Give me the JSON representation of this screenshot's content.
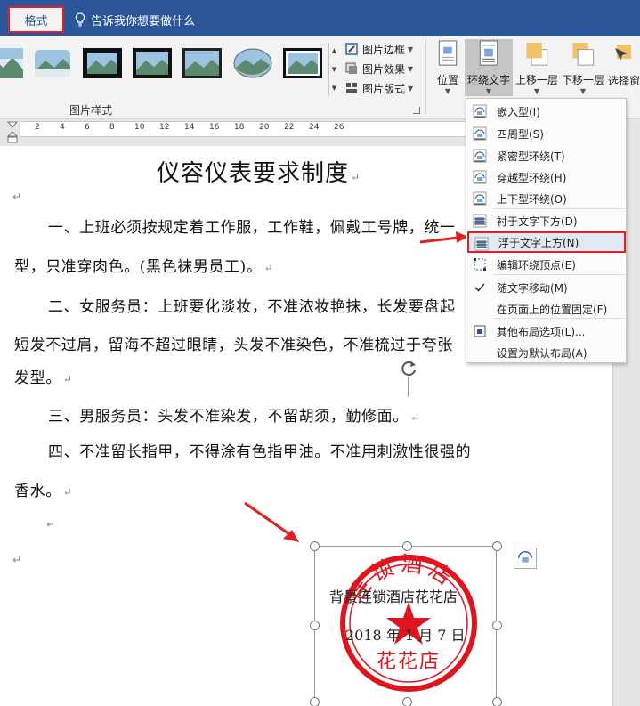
{
  "tabs": {
    "format_label": "格式",
    "tell_me_text": "告诉我你想要做什么"
  },
  "ribbon": {
    "picture_styles_label": "图片样式",
    "picture_border_label": "图片边框",
    "picture_effects_label": "图片效果",
    "picture_layout_label": "图片版式",
    "position_label": "位置",
    "wrap_text_label": "环绕文字",
    "bring_forward_label": "上移一层",
    "send_backward_label": "下移一层",
    "selection_pane_label": "选择窗"
  },
  "ruler": {
    "ticks": [
      "2",
      "4",
      "6",
      "8",
      "10",
      "12",
      "14",
      "16",
      "18",
      "20",
      "22",
      "24",
      "26"
    ]
  },
  "document": {
    "title": "仪容仪表要求制度",
    "lines": [
      "一、上班必须按规定着工作服，工作鞋，佩戴工号牌，统一",
      "型，只准穿肉色。(黑色袜男员工)。",
      "二、女服务员：上班要化淡妆，不准浓妆艳抹，长发要盘起",
      "短发不过肩，留海不超过眼睛，头发不准染色，不准梳过于夸张",
      "发型。",
      "三、男服务员：头发不准染发，不留胡须，勤修面。",
      "四、不准留长指甲，不得涂有色指甲油。不准用刺激性很强的",
      "香水。"
    ]
  },
  "image": {
    "caption_line1": "背景连锁酒店花花店",
    "caption_line2": "2018 年 1 月 7 日",
    "stamp_arc_text": "连锁酒店",
    "stamp_bottom_text": "花花店"
  },
  "wrap_menu": {
    "items": [
      {
        "label": "嵌入型(I)",
        "icon": "inline-icon"
      },
      {
        "label": "四周型(S)",
        "icon": "square-wrap-icon"
      },
      {
        "label": "紧密型环绕(T)",
        "icon": "tight-wrap-icon"
      },
      {
        "label": "穿越型环绕(H)",
        "icon": "through-wrap-icon"
      },
      {
        "label": "上下型环绕(O)",
        "icon": "top-bottom-wrap-icon"
      },
      {
        "label": "衬于文字下方(D)",
        "icon": "behind-text-icon"
      },
      {
        "label": "浮于文字上方(N)",
        "icon": "in-front-of-text-icon",
        "highlighted": true
      },
      {
        "label": "编辑环绕顶点(E)",
        "icon": "edit-wrap-points-icon"
      },
      {
        "label": "随文字移动(M)",
        "icon": "checkmark-icon",
        "checked": true
      },
      {
        "label": "在页面上的位置固定(F)",
        "icon": "none"
      },
      {
        "label": "其他布局选项(L)...",
        "icon": "more-layout-icon"
      },
      {
        "label": "设置为默认布局(A)",
        "icon": "none"
      }
    ]
  },
  "colors": {
    "title_bar": "#2b579a",
    "highlight_red": "#e02020",
    "stamp_red": "#e0141e"
  }
}
